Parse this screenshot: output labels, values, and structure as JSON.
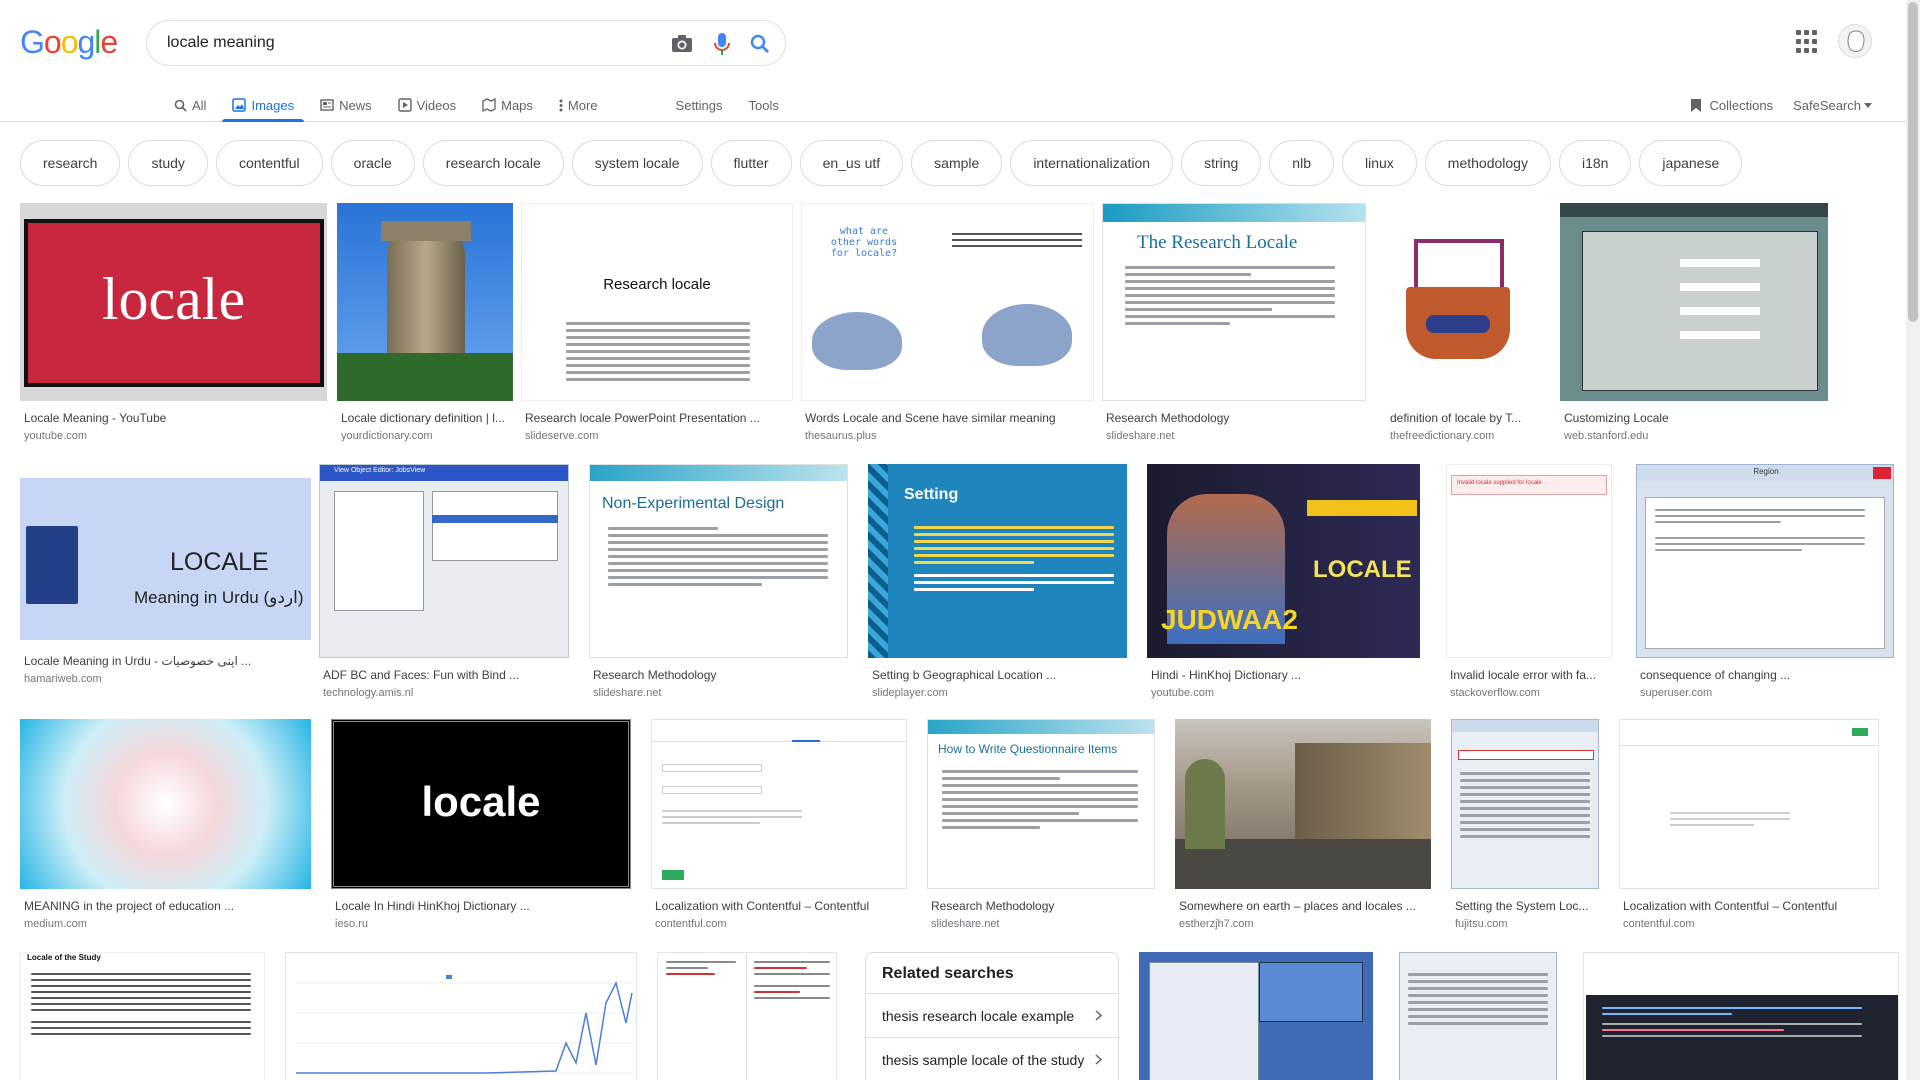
{
  "search": {
    "query": "locale meaning"
  },
  "logo": {
    "letters": [
      "G",
      "o",
      "o",
      "g",
      "l",
      "e"
    ],
    "colors": [
      "#4285f4",
      "#ea4335",
      "#fbbc05",
      "#4285f4",
      "#34a853",
      "#ea4335"
    ]
  },
  "tabs": [
    {
      "label": "All",
      "icon": "search-icon"
    },
    {
      "label": "Images",
      "icon": "image-icon",
      "active": true
    },
    {
      "label": "News",
      "icon": "news-icon"
    },
    {
      "label": "Videos",
      "icon": "video-icon"
    },
    {
      "label": "Maps",
      "icon": "map-icon"
    },
    {
      "label": "More",
      "icon": "more-vert-icon"
    },
    {
      "label": "Settings"
    },
    {
      "label": "Tools"
    }
  ],
  "right_tools": {
    "collections": "Collections",
    "safesearch": "SafeSearch"
  },
  "chips": [
    "research",
    "study",
    "contentful",
    "oracle",
    "research locale",
    "system locale",
    "flutter",
    "en_us utf",
    "sample",
    "internationalization",
    "string",
    "nlb",
    "linux",
    "methodology",
    "i18n",
    "japanese"
  ],
  "rows": [
    [
      {
        "caption": "Locale Meaning - YouTube",
        "source": "youtube.com",
        "thumb_text": "locale"
      },
      {
        "caption": "Locale dictionary definition | l...",
        "source": "yourdictionary.com"
      },
      {
        "caption": "Research locale PowerPoint Presentation ...",
        "source": "slideserve.com",
        "thumb_text": "Research locale"
      },
      {
        "caption": "Words Locale and Scene have similar meaning",
        "source": "thesaurus.plus",
        "thumb_text": "what are other words for locale?"
      },
      {
        "caption": "Research Methodology",
        "source": "slideshare.net",
        "thumb_text": "The Research Locale"
      },
      {
        "caption": "definition of locale by T...",
        "source": "thefreedictionary.com"
      },
      {
        "caption": "Customizing Locale",
        "source": "web.stanford.edu"
      }
    ],
    [
      {
        "caption": "Locale Meaning in Urdu - اپنی خصوصیات ...",
        "source": "hamariweb.com",
        "thumb_text": "LOCALE",
        "thumb_sub": "Meaning in Urdu (اردو)"
      },
      {
        "caption": "ADF BC and Faces: Fun with Bind ...",
        "source": "technology.amis.nl",
        "thumb_text": "View Object Editor: JobsView"
      },
      {
        "caption": "Research Methodology",
        "source": "slideshare.net",
        "thumb_text": "Non-Experimental Design"
      },
      {
        "caption": "Setting b Geographical Location ...",
        "source": "slideplayer.com",
        "thumb_text": "Setting"
      },
      {
        "caption": "Hindi - HinKhoj Dictionary ...",
        "source": "youtube.com",
        "thumb_text": "LOCALE"
      },
      {
        "caption": "Invalid locale error with fa...",
        "source": "stackoverflow.com",
        "thumb_text": "Invalid locale supplied for locale"
      },
      {
        "caption": "consequence of changing ...",
        "source": "superuser.com",
        "thumb_text": "Region"
      }
    ],
    [
      {
        "caption": "MEANING in the project of education ...",
        "source": "medium.com"
      },
      {
        "caption": "Locale In Hindi HinKhoj Dictionary ...",
        "source": "ieso.ru",
        "thumb_text": "locale"
      },
      {
        "caption": "Localization with Contentful – Contentful",
        "source": "contentful.com"
      },
      {
        "caption": "Research Methodology",
        "source": "slideshare.net",
        "thumb_text": "How to Write Questionnaire Items"
      },
      {
        "caption": "Somewhere on earth – places and locales ...",
        "source": "estherzjh7.com"
      },
      {
        "caption": "Setting the System Loc...",
        "source": "fujitsu.com"
      },
      {
        "caption": "Localization with Contentful – Contentful",
        "source": "contentful.com"
      }
    ]
  ],
  "row4": {
    "thumb_text": "Locale of the Study"
  },
  "related": {
    "title": "Related searches",
    "items": [
      "thesis research locale example",
      "thesis sample locale of the study"
    ]
  }
}
